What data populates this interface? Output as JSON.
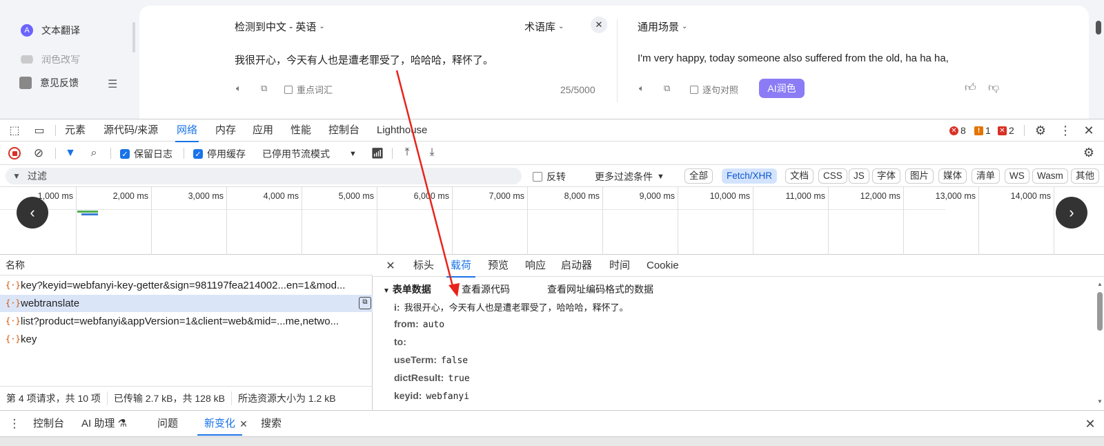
{
  "app": {
    "sidebar": [
      {
        "label": "文本翻译",
        "icon": "translate-icon"
      },
      {
        "label": "润色改写",
        "icon": "polish-icon"
      },
      {
        "label": "意见反馈",
        "icon": "feedback-icon"
      }
    ],
    "source_lang": "检测到中文 - 英语",
    "glossary": "术语库",
    "scene": "通用场景",
    "source_text": "我很开心，今天有人也是遭老罪受了，哈哈哈，释怀了。",
    "target_text": "I'm very happy, today someone also suffered from the old, ha ha ha,",
    "key_terms_label": "重点词汇",
    "char_count": "25/5000",
    "sentence_compare_label": "逐句对照",
    "ai_button": "AI润色",
    "accent": "#8b7cf6"
  },
  "devtools": {
    "tabs": [
      "元素",
      "源代码/来源",
      "网络",
      "内存",
      "应用",
      "性能",
      "控制台",
      "Lighthouse"
    ],
    "active_tab": "网络",
    "errors": "8",
    "warnings": "1",
    "issues": "2",
    "toolbar": {
      "preserve_log": "保留日志",
      "disable_cache": "停用缓存",
      "throttle": "已停用节流模式"
    },
    "filter": {
      "placeholder": "过滤",
      "invert": "反转",
      "more_filters": "更多过滤条件",
      "types": [
        "全部",
        "Fetch/XHR",
        "文档",
        "CSS",
        "JS",
        "字体",
        "图片",
        "媒体",
        "清单",
        "WS",
        "Wasm",
        "其他"
      ],
      "active_type": "Fetch/XHR"
    },
    "timeline_ticks": [
      "1,000 ms",
      "2,000 ms",
      "3,000 ms",
      "4,000 ms",
      "5,000 ms",
      "6,000 ms",
      "7,000 ms",
      "8,000 ms",
      "9,000 ms",
      "10,000 ms",
      "11,000 ms",
      "12,000 ms",
      "13,000 ms",
      "14,000 ms",
      "15,0"
    ],
    "requests_header": "名称",
    "requests": [
      "key?keyid=webfanyi-key-getter&sign=981197fea214002...en=1&mod...",
      "webtranslate",
      "list?product=webfanyi&appVersion=1&client=web&mid=...me,netwo...",
      "key"
    ],
    "selected_request": 1,
    "status": {
      "count": "第 4 项请求，共 10 项",
      "transferred": "已传输 2.7 kB，共 128 kB",
      "resources": "所选资源大小为 1.2 kB"
    },
    "detail_tabs": [
      "标头",
      "载荷",
      "预览",
      "响应",
      "启动器",
      "时间",
      "Cookie"
    ],
    "active_detail_tab": "载荷",
    "payload": {
      "section": "表单数据",
      "view_source": "查看源代码",
      "view_url_encoded": "查看网址编码格式的数据",
      "fields": [
        {
          "k": "i:",
          "v": "我很开心，今天有人也是遭老罪受了，哈哈哈，释怀了。"
        },
        {
          "k": "from:",
          "v": "auto"
        },
        {
          "k": "to:",
          "v": ""
        },
        {
          "k": "useTerm:",
          "v": "false"
        },
        {
          "k": "dictResult:",
          "v": "true"
        },
        {
          "k": "keyid:",
          "v": "webfanyi"
        }
      ]
    },
    "drawer_tabs": [
      "控制台",
      "AI 助理 ⚗",
      "问题",
      "新变化",
      "搜索"
    ],
    "active_drawer_tab": "新变化"
  }
}
